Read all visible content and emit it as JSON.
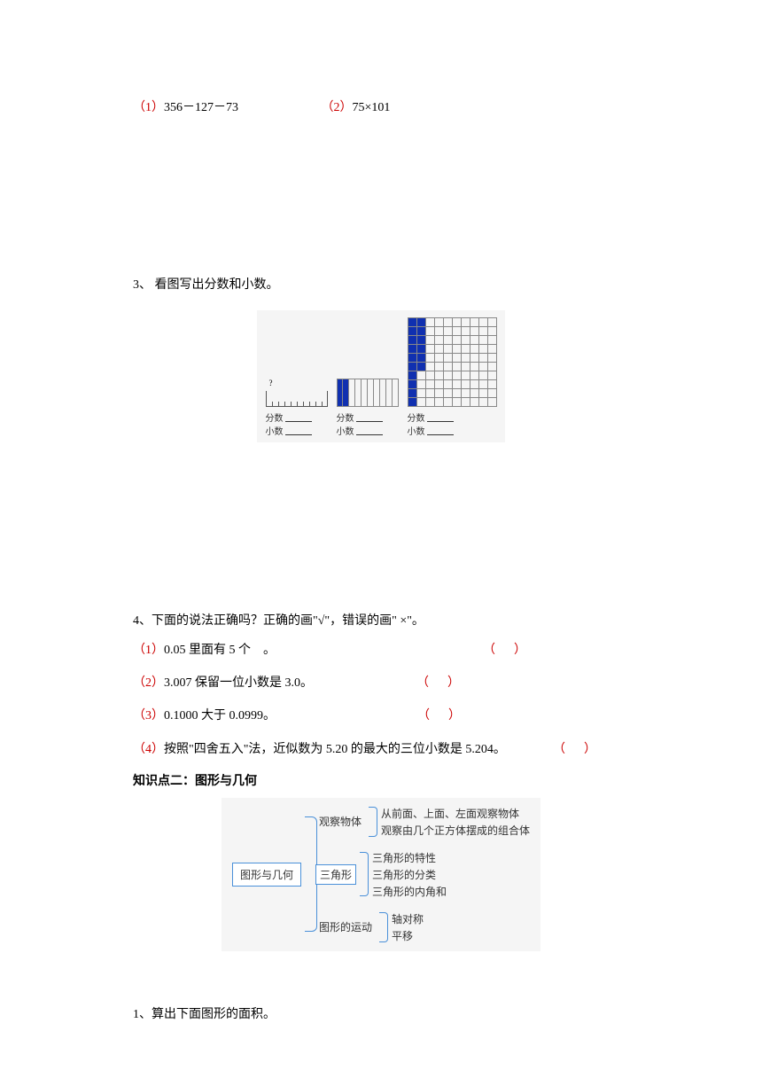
{
  "prob1": {
    "label": "（1）",
    "expression": "356－127－73"
  },
  "prob2": {
    "label": "（2）",
    "expression": "75×101"
  },
  "q3": {
    "title": "3、 看图写出分数和小数。",
    "panel_labels": {
      "fraction": "分数",
      "decimal": "小数"
    },
    "ruler_mark": "?"
  },
  "q4": {
    "title": "4、下面的说法正确吗？正确的画\"√\"，错误的画\" ×\"。",
    "items": [
      {
        "label": "（1）",
        "text_a": "0.05 里面有 5 个",
        "text_b": "。"
      },
      {
        "label": "（2）",
        "text": "3.007 保留一位小数是 3.0。"
      },
      {
        "label": "（3）",
        "text": "0.1000 大于 0.0999。"
      },
      {
        "label": "（4）",
        "text": "按照\"四舍五入\"法，近似数为 5.20 的最大的三位小数是 5.204。"
      }
    ],
    "paren_open": "（",
    "paren_close": "）"
  },
  "heading2": "知识点二：图形与几何",
  "concept_map": {
    "root": "图形与几何",
    "branches": [
      {
        "name": "观察物体",
        "children": [
          "从前面、上面、左面观察物体",
          "观察由几个正方体摆成的组合体"
        ]
      },
      {
        "name": "三角形",
        "children": [
          "三角形的特性",
          "三角形的分类",
          "三角形的内角和"
        ]
      },
      {
        "name": "图形的运动",
        "children": [
          "轴对称",
          "平移"
        ]
      }
    ]
  },
  "q_last": "1、算出下面图形的面积。"
}
